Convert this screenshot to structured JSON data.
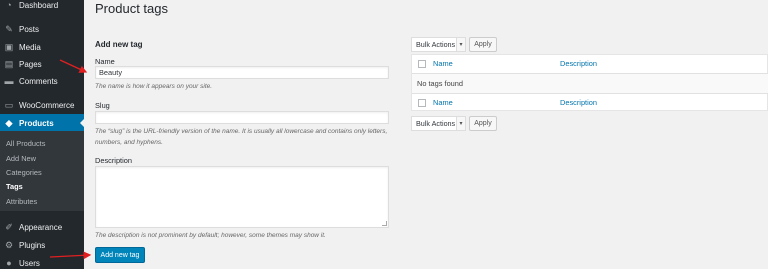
{
  "sidebar": {
    "items": [
      {
        "label": "Dashboard",
        "icon": "dashboard-icon"
      },
      {
        "label": "Posts",
        "icon": "pin-icon"
      },
      {
        "label": "Media",
        "icon": "media-icon"
      },
      {
        "label": "Pages",
        "icon": "page-icon"
      },
      {
        "label": "Comments",
        "icon": "comment-icon"
      },
      {
        "label": "WooCommerce",
        "icon": "woocommerce-icon"
      },
      {
        "label": "Products",
        "icon": "cube-icon"
      },
      {
        "label": "Appearance",
        "icon": "brush-icon"
      },
      {
        "label": "Plugins",
        "icon": "plugin-icon"
      },
      {
        "label": "Users",
        "icon": "user-icon"
      }
    ],
    "submenu": [
      "All Products",
      "Add New",
      "Categories",
      "Tags",
      "Attributes"
    ]
  },
  "main": {
    "title": "Product tags",
    "form": {
      "section_title": "Add new tag",
      "name_label": "Name",
      "name_value": "Beauty",
      "name_help": "The name is how it appears on your site.",
      "slug_label": "Slug",
      "slug_value": "",
      "slug_help_1": "The “slug” is the URL-friendly version of the name. It is usually all lowercase and contains only letters,",
      "slug_help_2": "numbers, and hyphens.",
      "description_label": "Description",
      "description_help": "The description is not prominent by default; however, some themes may show it.",
      "submit_label": "Add new tag"
    },
    "table": {
      "bulk_actions": "Bulk Actions",
      "apply": "Apply",
      "columns": [
        "Name",
        "Description"
      ],
      "empty_message": "No tags found"
    }
  },
  "colors": {
    "sidebar_bg": "#23282d",
    "active_bg": "#0073aa",
    "primary_button": "#0085ba",
    "link": "#0073aa",
    "annotation_arrow": "#e02020"
  }
}
